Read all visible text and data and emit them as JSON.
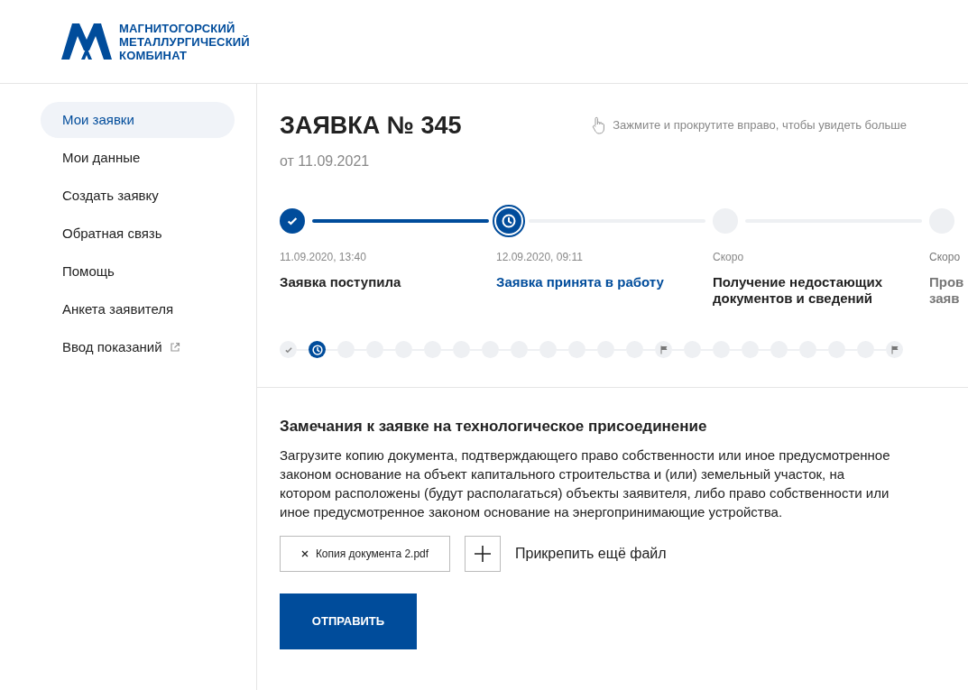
{
  "logo": {
    "lines": [
      "МАГНИТОГОРСКИЙ",
      "МЕТАЛЛУРГИЧЕСКИЙ",
      "КОМБИНАТ"
    ]
  },
  "sidebar": {
    "items": [
      {
        "label": "Мои заявки",
        "selected": true,
        "external": false
      },
      {
        "label": "Мои данные",
        "selected": false,
        "external": false
      },
      {
        "label": "Создать заявку",
        "selected": false,
        "external": false
      },
      {
        "label": "Обратная связь",
        "selected": false,
        "external": false
      },
      {
        "label": "Помощь",
        "selected": false,
        "external": false
      },
      {
        "label": "Анкета заявителя",
        "selected": false,
        "external": false
      },
      {
        "label": "Ввод показаний",
        "selected": false,
        "external": true
      }
    ]
  },
  "request": {
    "title": "ЗАЯВКА № 345",
    "date": "от 11.09.2021",
    "hint": "Зажмите и прокрутите вправо, чтобы увидеть больше"
  },
  "steps": [
    {
      "kind": "done",
      "time": "11.09.2020, 13:40",
      "title": "Заявка поступила"
    },
    {
      "kind": "current",
      "time": "12.09.2020, 09:11",
      "title": "Заявка принята в работу"
    },
    {
      "kind": "pending",
      "time": "Скоро",
      "title": "Получение недостающих документов и сведений"
    },
    {
      "kind": "pending",
      "time": "Скоро",
      "title": "Пров заяв"
    }
  ],
  "mini_steps": [
    {
      "kind": "done"
    },
    {
      "kind": "current"
    },
    {
      "kind": "pending"
    },
    {
      "kind": "pending"
    },
    {
      "kind": "pending"
    },
    {
      "kind": "pending"
    },
    {
      "kind": "pending"
    },
    {
      "kind": "pending"
    },
    {
      "kind": "pending"
    },
    {
      "kind": "pending"
    },
    {
      "kind": "pending"
    },
    {
      "kind": "pending"
    },
    {
      "kind": "pending"
    },
    {
      "kind": "flag"
    },
    {
      "kind": "pending"
    },
    {
      "kind": "pending"
    },
    {
      "kind": "pending"
    },
    {
      "kind": "pending"
    },
    {
      "kind": "pending"
    },
    {
      "kind": "pending"
    },
    {
      "kind": "pending"
    },
    {
      "kind": "flag"
    }
  ],
  "remarks": {
    "heading": "Замечания к заявке на технологическое присоединение",
    "text": "Загрузите копию документа, подтверждающего право собственности или иное предусмотренное законом основание на объект капитального строительства и (или) земельный участок, на котором расположены (будут располагаться) объекты заявителя, либо право собственности или иное предусмотренное законом основание на энергопринимающие устройства.",
    "files": [
      {
        "name": "Копия документа 2.pdf"
      }
    ],
    "attach_label": "Прикрепить ещё файл",
    "submit": "ОТПРАВИТЬ"
  }
}
